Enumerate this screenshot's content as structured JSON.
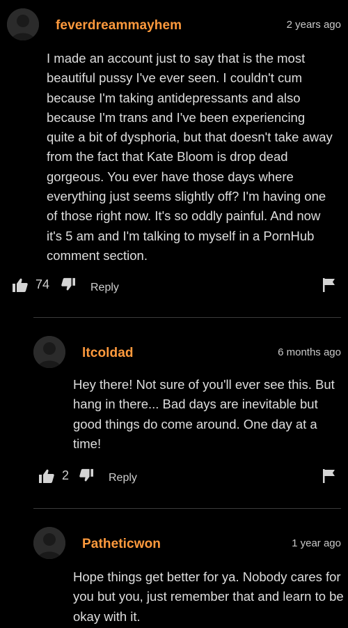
{
  "comments": [
    {
      "username": "feverdreammayhem",
      "timestamp": "2 years ago",
      "text": "I made an account just to say that is the most beautiful pussy I've ever seen. I couldn't cum because I'm taking antidepressants and also because I'm trans and I've been experiencing quite a bit of dysphoria, but that doesn't take away from the fact that Kate Bloom is drop dead gorgeous. You ever have those days where everything just seems slightly off? I'm having one of those right now. It's so oddly painful. And now it's 5 am and I'm talking to myself in a PornHub comment section.",
      "likes": "74",
      "reply_label": "Reply"
    },
    {
      "username": "ltcoldad",
      "timestamp": "6 months ago",
      "text": "Hey there! Not sure of you'll ever see this. But hang in there... Bad days are inevitable but good things do come around. One day at a time!",
      "likes": "2",
      "reply_label": "Reply"
    },
    {
      "username": "Patheticwon",
      "timestamp": "1 year ago",
      "text": "Hope things get better for ya. Nobody cares for you but you, just remember that and learn to be okay with it."
    }
  ],
  "icons": {
    "thumbs_up": "thumbs-up-icon",
    "thumbs_down": "thumbs-down-icon",
    "flag": "flag-icon",
    "avatar": "default-avatar"
  },
  "colors": {
    "background": "#000000",
    "username": "#ff9a3d",
    "text": "#dedede",
    "divider": "#3b3b3b"
  }
}
